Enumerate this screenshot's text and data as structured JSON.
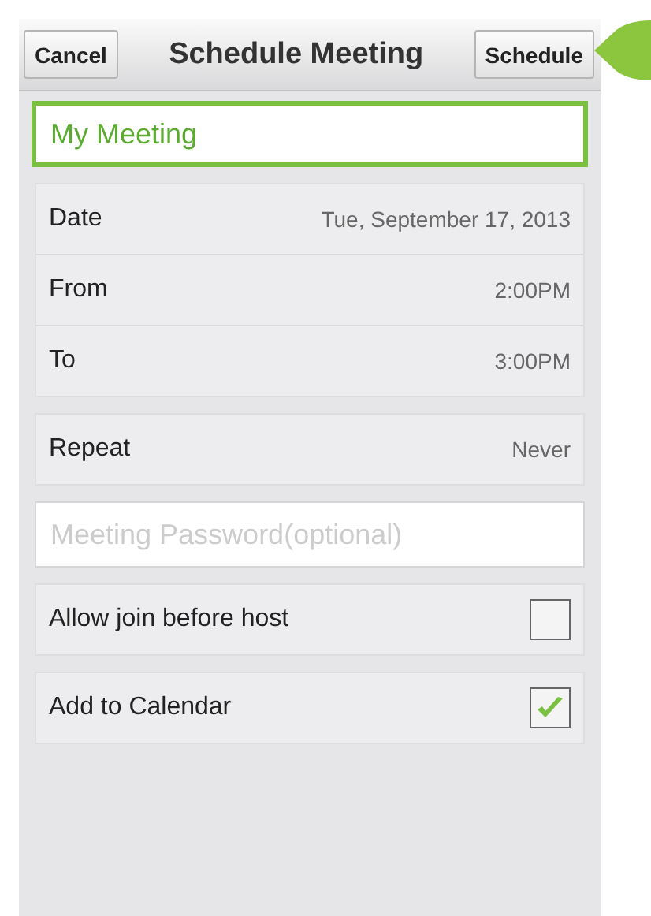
{
  "header": {
    "cancel": "Cancel",
    "title": "Schedule Meeting",
    "schedule": "Schedule"
  },
  "name_field": {
    "value": "My Meeting"
  },
  "time_rows": [
    {
      "label": "Date",
      "value": "Tue, September 17, 2013"
    },
    {
      "label": "From",
      "value": "2:00PM"
    },
    {
      "label": "To",
      "value": "3:00PM"
    }
  ],
  "repeat": {
    "label": "Repeat",
    "value": "Never"
  },
  "password_field": {
    "placeholder": "Meeting Password(optional)"
  },
  "options": [
    {
      "label": "Allow join before host",
      "checked": false
    },
    {
      "label": "Add to Calendar",
      "checked": true
    }
  ]
}
